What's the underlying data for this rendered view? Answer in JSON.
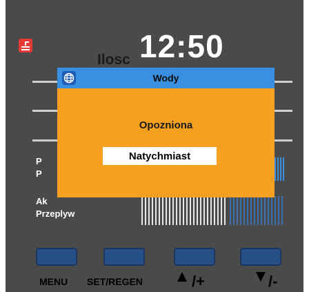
{
  "header": {
    "time": "12:50",
    "section_label": "Ilosc"
  },
  "left_labels": {
    "row1": "P",
    "row2": "P",
    "row3": "Ak",
    "row4": "Przeplyw"
  },
  "dialog": {
    "title": "Wody",
    "options": [
      "Opozniona",
      "Natychmiast"
    ],
    "selected_index": 1
  },
  "buttons": {
    "menu": "MENU",
    "set_regen": "SET/REGEN",
    "up": "/+",
    "down": "/-"
  },
  "icons": {
    "brand": "app-logo-icon",
    "dialog": "globe-icon",
    "up": "triangle-up-icon",
    "down": "triangle-down-icon"
  },
  "colors": {
    "background": "#4a4a4a",
    "dialog": "#f5a020",
    "dialog_title": "#3a8fe0",
    "button": "#264f86",
    "brand": "#e53935"
  }
}
